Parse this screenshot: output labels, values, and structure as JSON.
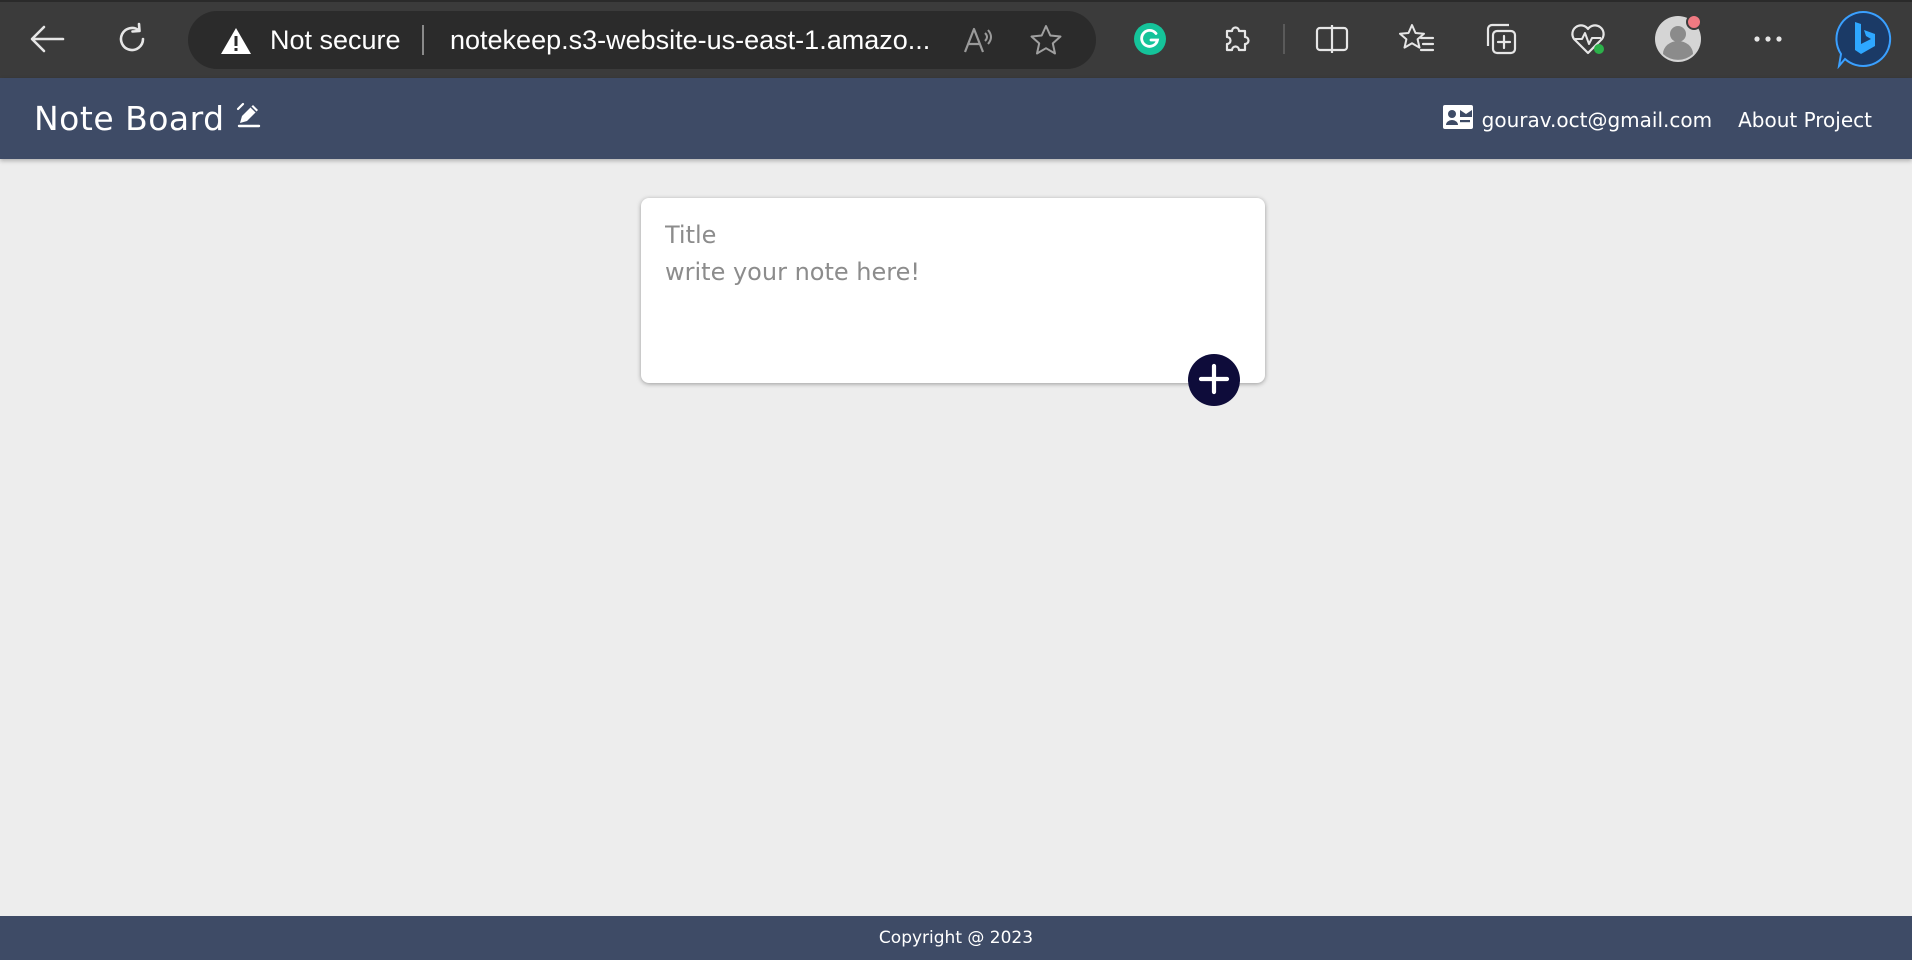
{
  "browser": {
    "security_label": "Not secure",
    "url": "notekeep.s3-website-us-east-1.amazo...",
    "icons": [
      "back-icon",
      "refresh-icon",
      "warning-icon",
      "read-aloud-icon",
      "favorite-star-icon",
      "grammarly-icon",
      "extensions-icon",
      "split-screen-icon",
      "favorites-icon",
      "collections-icon",
      "browser-essentials-icon",
      "profile-avatar",
      "more-icon",
      "bing-copilot-icon"
    ],
    "colors": {
      "chrome_bg": "#3b3b3b",
      "address_bg": "#2b2b2b",
      "grammarly": "#15c39a",
      "bing": "#1e7bd8"
    }
  },
  "header": {
    "title": "Note Board",
    "title_icon": "edit-pen-icon",
    "email": "gourav.oct@gmail.com",
    "email_icon": "contact-card-icon",
    "about": "About Project",
    "bg_color": "#3e4b66"
  },
  "note_form": {
    "title_placeholder": "Title",
    "body_placeholder": "write your note here!",
    "add_icon": "plus-icon",
    "add_button_color": "#0e0c3a"
  },
  "footer": {
    "text": "Copyright @ 2023"
  }
}
